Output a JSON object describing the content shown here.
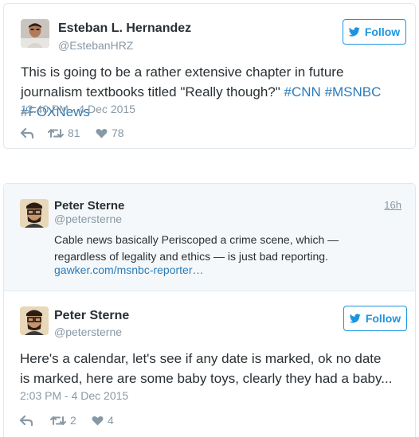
{
  "tweet1": {
    "name": "Esteban L. Hernandez",
    "handle": "@EstebanHRZ",
    "follow_label": "Follow",
    "text_main": "This is going to be a rather extensive chapter in future journalism textbooks titled \"Really though?\" ",
    "hashtags": [
      "#CNN",
      "#MSNBC",
      "#FOXNews"
    ],
    "timestamp": "12:40 PM - 4 Dec 2015",
    "retweets": "81",
    "likes": "78"
  },
  "quoted": {
    "name": "Peter Sterne",
    "handle": "@petersterne",
    "relative_time": "16h",
    "text": "Cable news basically Periscoped a crime scene, which — regardless of legality and ethics — is just bad reporting.",
    "link": "gawker.com/msnbc-reporter…"
  },
  "tweet2": {
    "name": "Peter Sterne",
    "handle": "@petersterne",
    "follow_label": "Follow",
    "text": "Here's a calendar, let's see if any date is marked, ok no date is marked, here are some baby toys, clearly they had a baby...",
    "timestamp": "2:03 PM - 4 Dec 2015",
    "retweets": "2",
    "likes": "4"
  },
  "colors": {
    "accent": "#1b95e0",
    "link": "#2b7bb9",
    "muted": "#8899a6",
    "text": "#292f33",
    "border": "#e1e8ed",
    "quoted_bg": "#f5f8fa"
  }
}
